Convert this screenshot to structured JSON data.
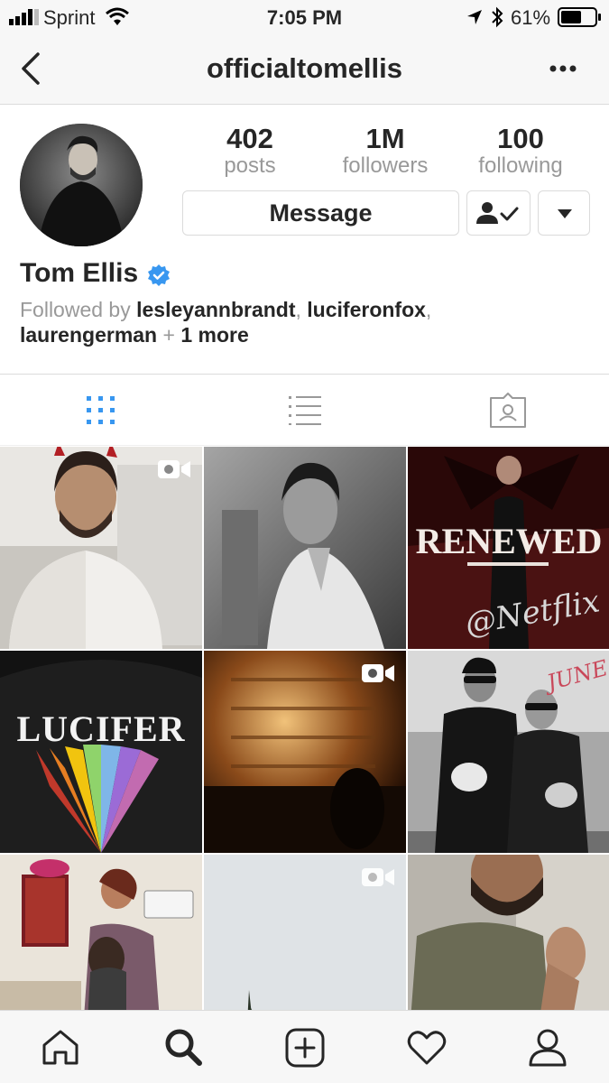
{
  "status_bar": {
    "carrier": "Sprint",
    "time": "7:05 PM",
    "battery": "61%"
  },
  "header": {
    "username": "officialtomellis"
  },
  "profile": {
    "stats": [
      {
        "value": "402",
        "label": "posts"
      },
      {
        "value": "1M",
        "label": "followers"
      },
      {
        "value": "100",
        "label": "following"
      }
    ],
    "message_label": "Message",
    "name": "Tom Ellis",
    "followed_by": {
      "prefix": "Followed by",
      "user1": "lesleyannbrandt",
      "user2": "luciferonfox",
      "user3": "laurengerman",
      "more": "1 more"
    }
  },
  "grid": {
    "tiles": [
      {
        "has_video": true
      },
      {
        "has_video": false
      },
      {
        "has_video": false,
        "caption": "RENEWED",
        "handwriting": "@Netflix"
      },
      {
        "has_video": false,
        "caption": "LUCIFER"
      },
      {
        "has_video": true
      },
      {
        "has_video": false,
        "handwriting": "JUNE"
      },
      {
        "has_video": false
      },
      {
        "has_video": true
      },
      {
        "has_video": false
      }
    ]
  },
  "colors": {
    "verified": "#3897f0",
    "accent": "#3897f0",
    "icon": "#262626",
    "muted": "#999999"
  },
  "icons": {
    "nav": [
      "back-arrow-icon",
      "more-dots-icon"
    ],
    "tabs": [
      "grid-icon",
      "list-icon",
      "tagged-icon"
    ],
    "tabbar": [
      "home-icon",
      "search-icon",
      "add-post-icon",
      "heart-icon",
      "profile-icon"
    ]
  }
}
